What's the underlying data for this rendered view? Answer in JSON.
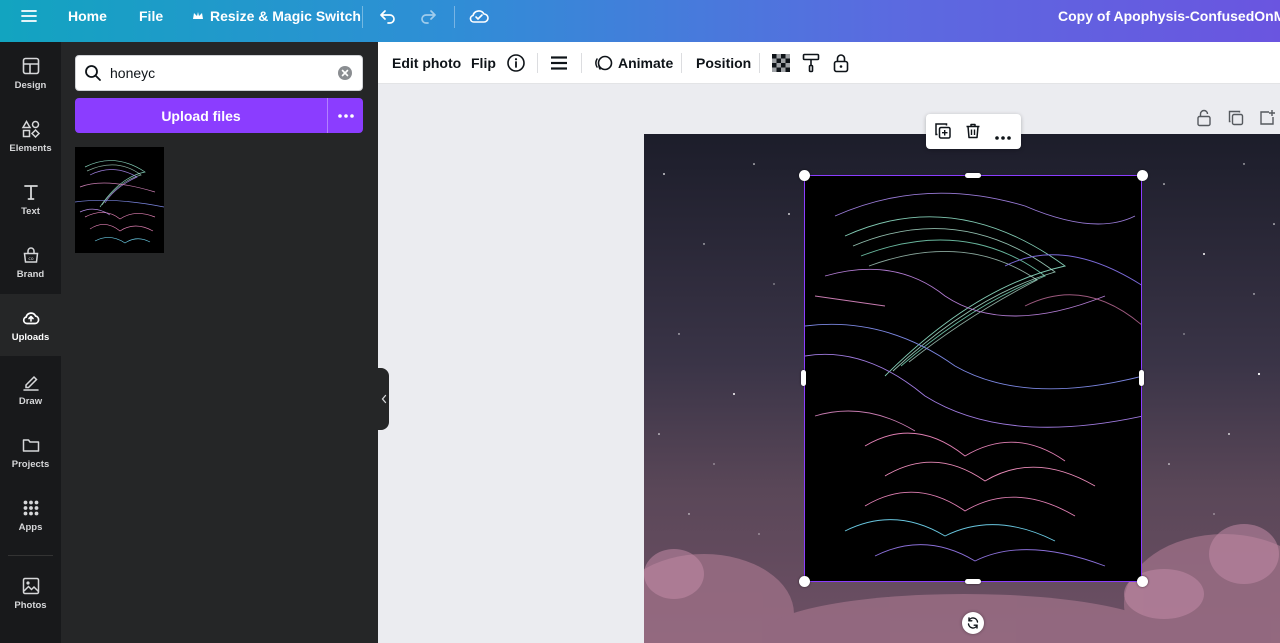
{
  "topbar": {
    "home": "Home",
    "file": "File",
    "resize": "Resize & Magic Switch",
    "doc_title": "Copy of Apophysis-ConfusedOnMany"
  },
  "rail": {
    "items": [
      {
        "label": "Design",
        "icon": "layout-icon"
      },
      {
        "label": "Elements",
        "icon": "shapes-icon"
      },
      {
        "label": "Text",
        "icon": "text-icon"
      },
      {
        "label": "Brand",
        "icon": "brand-icon"
      },
      {
        "label": "Uploads",
        "icon": "cloud-upload-icon"
      },
      {
        "label": "Draw",
        "icon": "pen-icon"
      },
      {
        "label": "Projects",
        "icon": "folder-icon"
      },
      {
        "label": "Apps",
        "icon": "grid-icon"
      },
      {
        "label": "Photos",
        "icon": "image-icon"
      }
    ],
    "active": "Uploads"
  },
  "panel": {
    "search_value": "honeyc",
    "upload_label": "Upload files"
  },
  "toolbar": {
    "edit_photo": "Edit photo",
    "flip": "Flip",
    "animate": "Animate",
    "position": "Position"
  },
  "colors": {
    "accent": "#8b3dff",
    "rail_bg": "#18191b",
    "panel_bg": "#252627"
  }
}
